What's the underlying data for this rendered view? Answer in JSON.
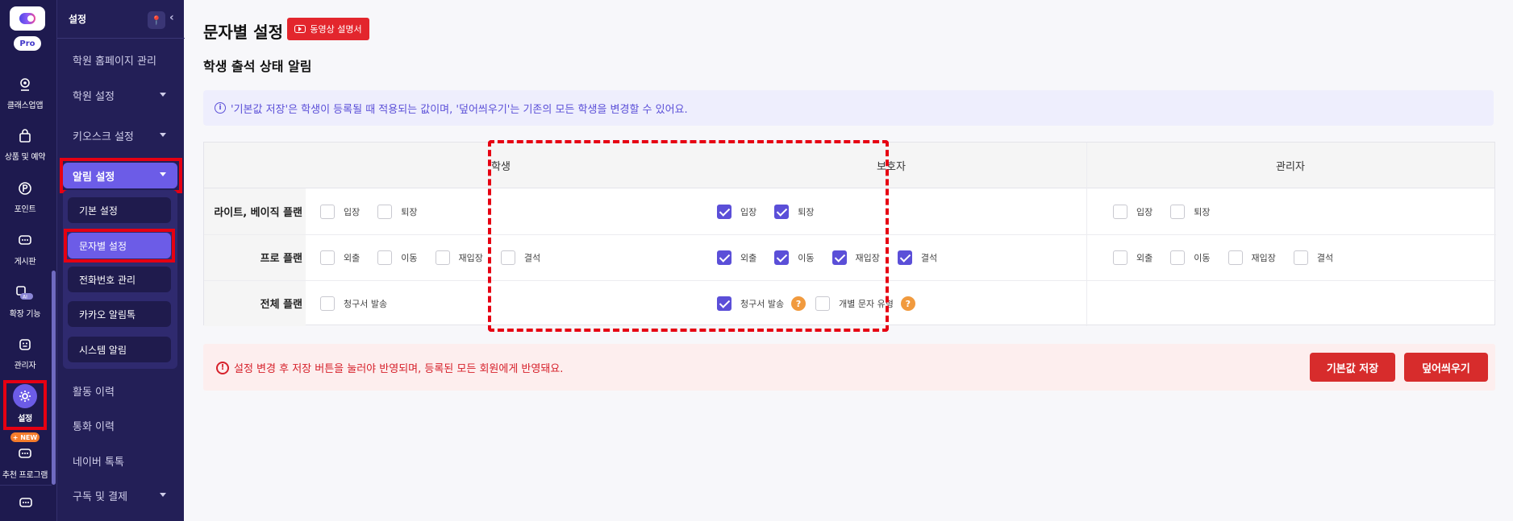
{
  "rail": {
    "pro_label": "Pro",
    "new_badge": "+ NEW",
    "items": [
      {
        "label": "클래스업앱",
        "icon": "camera-icon"
      },
      {
        "label": "상품 및 예약",
        "icon": "bag-icon"
      },
      {
        "label": "포인트",
        "icon": "point-icon"
      },
      {
        "label": "게시판",
        "icon": "chat-icon"
      },
      {
        "label": "확장 기능",
        "icon": "ai-extension-icon"
      },
      {
        "label": "관리자",
        "icon": "admin-icon"
      },
      {
        "label": "설정",
        "icon": "gear-icon"
      },
      {
        "label": "추천 프로그램",
        "icon": "referral-icon"
      }
    ]
  },
  "sidebar": {
    "title": "설정",
    "items": [
      {
        "label": "학원 홈페이지 관리"
      },
      {
        "label": "학원 설정"
      },
      {
        "label": "키오스크 설정"
      },
      {
        "label": "알림 설정"
      },
      {
        "label": "활동 이력"
      },
      {
        "label": "통화 이력"
      },
      {
        "label": "네이버 톡톡"
      },
      {
        "label": "구독 및 결제"
      }
    ],
    "sub_items": [
      {
        "label": "기본 설정"
      },
      {
        "label": "문자별 설정"
      },
      {
        "label": "전화번호 관리"
      },
      {
        "label": "카카오 알림톡"
      },
      {
        "label": "시스템 알림"
      }
    ]
  },
  "main": {
    "page_title": "문자별 설정",
    "video_button": "동영상 설명서",
    "section_title": "학생 출석 상태 알림",
    "info_text": "'기본값 저장'은 학생이 등록될 때 적용되는 값이며, '덮어씌우기'는 기존의 모든 학생을 변경할 수 있어요.",
    "columns": [
      "학생",
      "보호자",
      "관리자"
    ],
    "rows": [
      {
        "label": "라이트, 베이직 플랜",
        "student": [
          {
            "label": "입장",
            "checked": false
          },
          {
            "label": "퇴장",
            "checked": false
          }
        ],
        "guardian": [
          {
            "label": "입장",
            "checked": true
          },
          {
            "label": "퇴장",
            "checked": true
          }
        ],
        "admin": [
          {
            "label": "입장",
            "checked": false
          },
          {
            "label": "퇴장",
            "checked": false
          }
        ]
      },
      {
        "label": "프로 플랜",
        "student": [
          {
            "label": "외출",
            "checked": false
          },
          {
            "label": "이동",
            "checked": false
          },
          {
            "label": "재입장",
            "checked": false
          },
          {
            "label": "결석",
            "checked": false
          }
        ],
        "guardian": [
          {
            "label": "외출",
            "checked": true
          },
          {
            "label": "이동",
            "checked": true
          },
          {
            "label": "재입장",
            "checked": true
          },
          {
            "label": "결석",
            "checked": true
          }
        ],
        "admin": [
          {
            "label": "외출",
            "checked": false
          },
          {
            "label": "이동",
            "checked": false
          },
          {
            "label": "재입장",
            "checked": false
          },
          {
            "label": "결석",
            "checked": false
          }
        ]
      },
      {
        "label": "전체 플랜",
        "student": [
          {
            "label": "청구서 발송",
            "checked": false
          }
        ],
        "guardian": [
          {
            "label": "청구서 발송",
            "checked": true
          },
          {
            "label": "개별 문자 유형",
            "checked": false
          }
        ]
      }
    ],
    "warning_text": "설정 변경 후 저장 버튼을 눌러야 반영되며, 등록된 모든 회원에게 반영돼요.",
    "save_default_button": "기본값 저장",
    "overwrite_button": "덮어씌우기"
  },
  "colors": {
    "accent": "#6c5ce7",
    "danger": "#d72c2c",
    "rail_bg": "#1e1a4f",
    "sidebar_bg": "#231f57"
  }
}
